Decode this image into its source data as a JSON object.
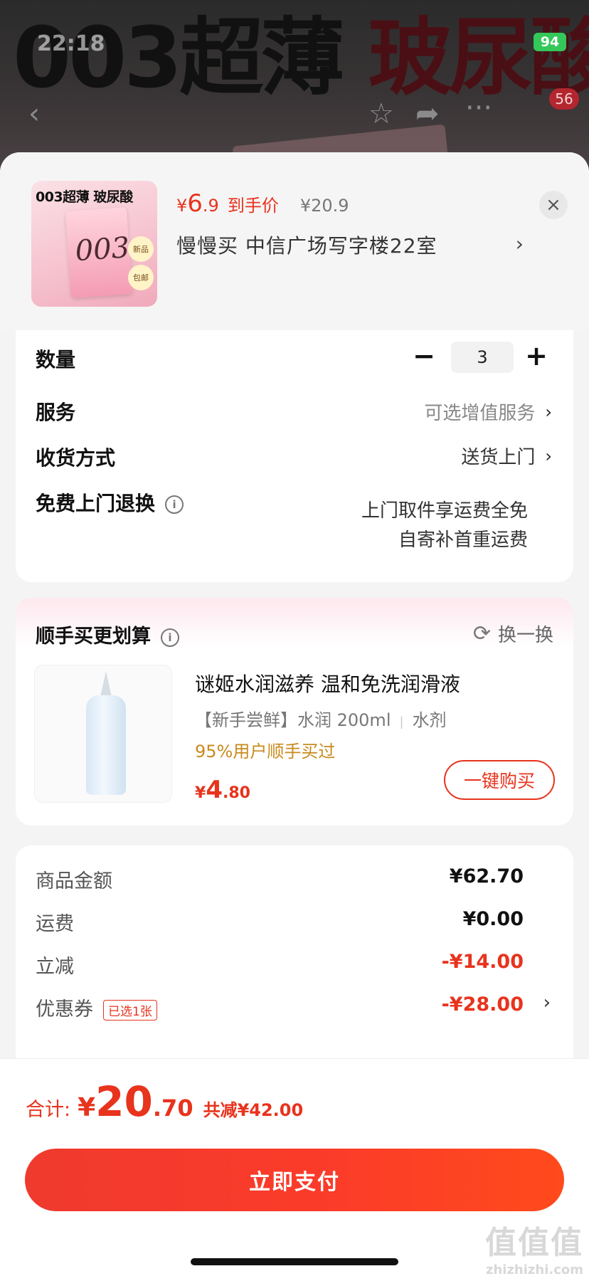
{
  "background": {
    "banner_text_black": "003超薄 ",
    "banner_text_red": "玻尿酸",
    "status_time": "22:18",
    "battery": "94",
    "cart_badge": "56"
  },
  "product": {
    "thumb_title": "003超薄 玻尿酸",
    "thumb_box_number": "003",
    "thumb_tag_1": "新品",
    "thumb_tag_2": "包邮",
    "price_yen": "¥",
    "price_int": "6",
    "price_dec": ".9",
    "price_tag": "到手价",
    "original_price": "¥20.9",
    "address": "慢慢买  中信广场写字楼22室"
  },
  "options": {
    "quantity_label": "数量",
    "quantity_value": "3",
    "service_label": "服务",
    "service_value": "可选增值服务",
    "delivery_label": "收货方式",
    "delivery_value": "送货上门",
    "return_label": "免费上门退换",
    "return_note_line1": "上门取件享运费全免",
    "return_note_line2": "自寄补首重运费"
  },
  "upsell": {
    "title": "顺手买更划算",
    "swap_label": "换一换",
    "name": "谜姬水润滋养 温和免洗润滑液",
    "spec_1": "【新手尝鲜】水润 200ml",
    "spec_2": "水剂",
    "social": "95%用户顺手买过",
    "price_yen": "¥",
    "price_int": "4",
    "price_dec": ".80",
    "buy_label": "一键购买"
  },
  "summary": {
    "goods_label": "商品金额",
    "goods_value": "¥62.70",
    "shipping_label": "运费",
    "shipping_value": "¥0.00",
    "discount_label": "立减",
    "discount_value": "-¥14.00",
    "coupon_label": "优惠券",
    "coupon_tag": "已选1张",
    "coupon_value": "-¥28.00"
  },
  "checkout": {
    "total_label": "合计:",
    "total_yen": "¥",
    "total_int": "20",
    "total_dec": ".70",
    "saved": "共减¥42.00",
    "pay_label": "立即支付"
  },
  "watermark": {
    "text": "值值值",
    "url": "zhizhizhi.com"
  },
  "colors": {
    "accent": "#e8331d",
    "social_proof": "#c98a1d"
  }
}
